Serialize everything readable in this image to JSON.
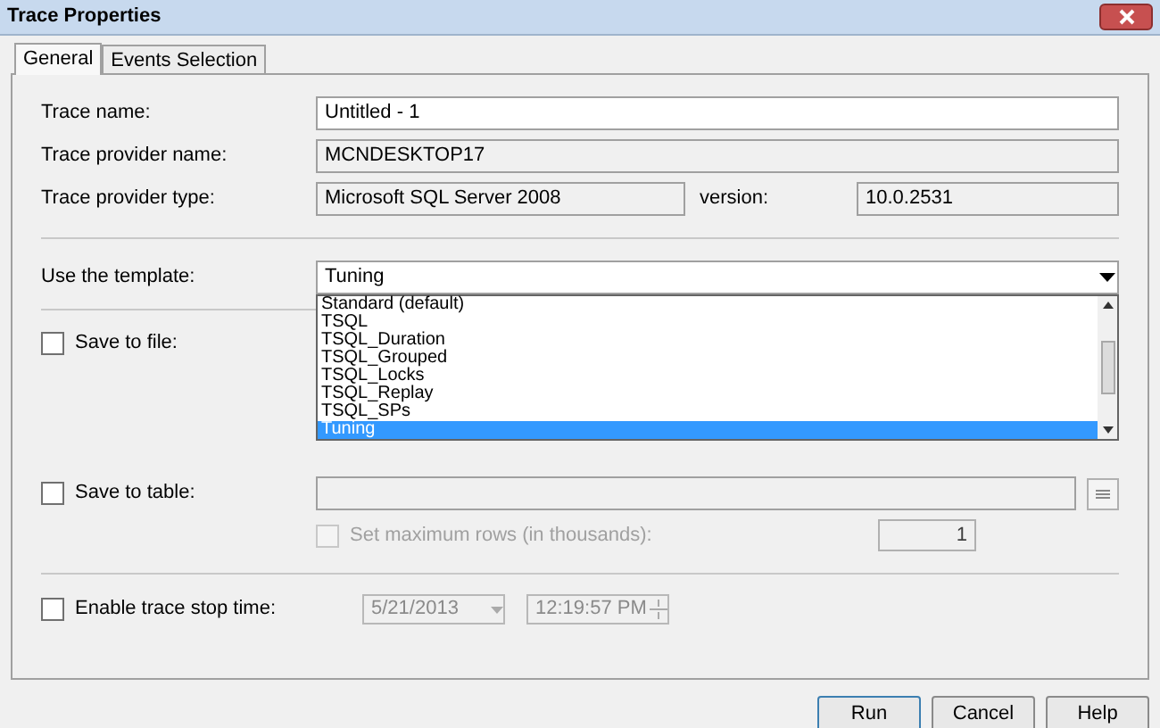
{
  "window": {
    "title": "Trace Properties"
  },
  "tabs": [
    {
      "label": "General",
      "selected": true
    },
    {
      "label": "Events Selection",
      "selected": false
    }
  ],
  "general": {
    "trace_name": {
      "label": "Trace name:",
      "value": "Untitled - 1"
    },
    "provider_name": {
      "label": "Trace provider name:",
      "value": "MCNDESKTOP17"
    },
    "provider_type": {
      "label": "Trace provider type:",
      "value": "Microsoft SQL Server 2008"
    },
    "version": {
      "label": "version:",
      "value": "10.0.2531"
    },
    "template": {
      "label": "Use the template:",
      "value": "Tuning",
      "expanded": true,
      "options": [
        {
          "label": "Standard (default)",
          "selected": false
        },
        {
          "label": "TSQL",
          "selected": false
        },
        {
          "label": "TSQL_Duration",
          "selected": false
        },
        {
          "label": "TSQL_Grouped",
          "selected": false
        },
        {
          "label": "TSQL_Locks",
          "selected": false
        },
        {
          "label": "TSQL_Replay",
          "selected": false
        },
        {
          "label": "TSQL_SPs",
          "selected": false
        },
        {
          "label": "Tuning",
          "selected": true
        }
      ]
    },
    "save_to_file": {
      "label": "Save to file:",
      "checked": false
    },
    "save_to_table": {
      "label": "Save to table:",
      "checked": false
    },
    "max_rows": {
      "label": "Set maximum rows (in thousands):",
      "checked": false,
      "disabled": true,
      "value": "1"
    },
    "stop_time": {
      "label": "Enable trace stop time:",
      "checked": false,
      "date": "5/21/2013",
      "time": "12:19:57 PM"
    }
  },
  "buttons": [
    "Run",
    "Cancel",
    "Help"
  ]
}
